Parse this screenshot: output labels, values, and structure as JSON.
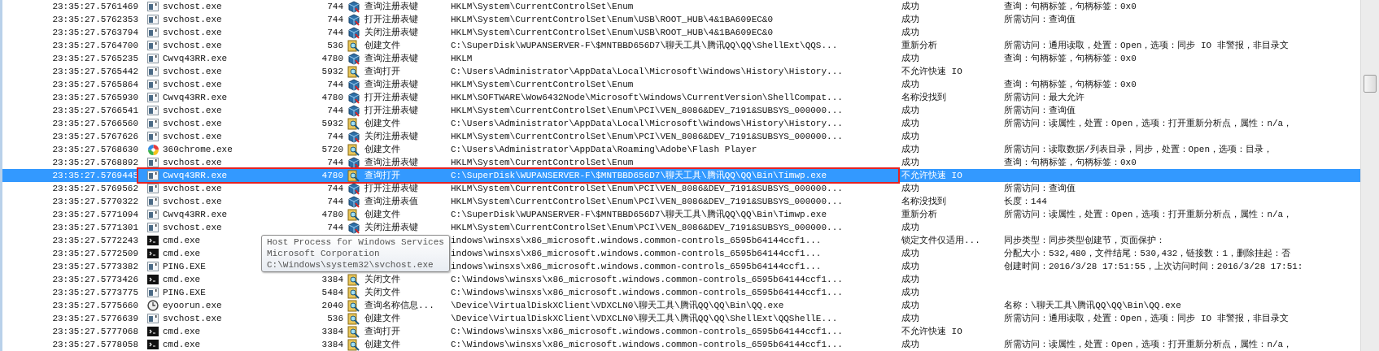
{
  "rows": [
    {
      "time": "23:35:27.5761469",
      "process": {
        "text": "svchost.exe",
        "kind": "app"
      },
      "pid": "744",
      "operation": {
        "text": "查询注册表键",
        "kind": "registry"
      },
      "path": "HKLM\\System\\CurrentControlSet\\Enum",
      "result": "成功",
      "detail": "查询：句柄标签，句柄标签：0x0",
      "selected": false,
      "outlined": false
    },
    {
      "time": "23:35:27.5762353",
      "process": {
        "text": "svchost.exe",
        "kind": "app"
      },
      "pid": "744",
      "operation": {
        "text": "打开注册表键",
        "kind": "registry"
      },
      "path": "HKLM\\System\\CurrentControlSet\\Enum\\USB\\ROOT_HUB\\4&1BA609EC&0",
      "result": "成功",
      "detail": "所需访问：查询值",
      "selected": false,
      "outlined": false
    },
    {
      "time": "23:35:27.5763794",
      "process": {
        "text": "svchost.exe",
        "kind": "app"
      },
      "pid": "744",
      "operation": {
        "text": "关闭注册表键",
        "kind": "registry"
      },
      "path": "HKLM\\System\\CurrentControlSet\\Enum\\USB\\ROOT_HUB\\4&1BA609EC&0",
      "result": "成功",
      "selected": false,
      "outlined": false
    },
    {
      "time": "23:35:27.5764700",
      "process": {
        "text": "svchost.exe",
        "kind": "app"
      },
      "pid": "536",
      "operation": {
        "text": "创建文件",
        "kind": "file"
      },
      "path": "C:\\SuperDisk\\WUPANSERVER-F\\$MNTBBD656D7\\聊天工具\\腾讯QQ\\QQ\\ShellExt\\QQS...",
      "result": "重新分析",
      "detail": "所需访问：通用读取，处置：Open，选项：同步 IO 非警报，非目录文",
      "selected": false,
      "outlined": false
    },
    {
      "time": "23:35:27.5765235",
      "process": {
        "text": "Cwvq43RR.exe",
        "kind": "app"
      },
      "pid": "4780",
      "operation": {
        "text": "查询注册表键",
        "kind": "registry"
      },
      "path": "HKLM",
      "result": "成功",
      "detail": "查询：句柄标签，句柄标签：0x0",
      "selected": false,
      "outlined": false
    },
    {
      "time": "23:35:27.5765442",
      "process": {
        "text": "svchost.exe",
        "kind": "app"
      },
      "pid": "5932",
      "operation": {
        "text": "查询打开",
        "kind": "file"
      },
      "path": "C:\\Users\\Administrator\\AppData\\Local\\Microsoft\\Windows\\History\\History...",
      "result": "不允许快速 IO",
      "selected": false,
      "outlined": false
    },
    {
      "time": "23:35:27.5765864",
      "process": {
        "text": "svchost.exe",
        "kind": "app"
      },
      "pid": "744",
      "operation": {
        "text": "查询注册表键",
        "kind": "registry"
      },
      "path": "HKLM\\System\\CurrentControlSet\\Enum",
      "result": "成功",
      "detail": "查询：句柄标签，句柄标签：0x0",
      "selected": false,
      "outlined": false
    },
    {
      "time": "23:35:27.5765930",
      "process": {
        "text": "Cwvq43RR.exe",
        "kind": "app"
      },
      "pid": "4780",
      "operation": {
        "text": "打开注册表键",
        "kind": "registry"
      },
      "path": "HKLM\\SOFTWARE\\Wow6432Node\\Microsoft\\Windows\\CurrentVersion\\ShellCompat...",
      "result": "名称没找到",
      "detail": "所需访问：最大允许",
      "selected": false,
      "outlined": false
    },
    {
      "time": "23:35:27.5766541",
      "process": {
        "text": "svchost.exe",
        "kind": "app"
      },
      "pid": "744",
      "operation": {
        "text": "打开注册表键",
        "kind": "registry"
      },
      "path": "HKLM\\System\\CurrentControlSet\\Enum\\PCI\\VEN_8086&DEV_7191&SUBSYS_000000...",
      "result": "成功",
      "detail": "所需访问：查询值",
      "selected": false,
      "outlined": false
    },
    {
      "time": "23:35:27.5766560",
      "process": {
        "text": "svchost.exe",
        "kind": "app"
      },
      "pid": "5932",
      "operation": {
        "text": "创建文件",
        "kind": "file"
      },
      "path": "C:\\Users\\Administrator\\AppData\\Local\\Microsoft\\Windows\\History\\History...",
      "result": "成功",
      "detail": "所需访问：读属性，处置：Open，选项：打开重新分析点，属性：n/a，",
      "selected": false,
      "outlined": false
    },
    {
      "time": "23:35:27.5767626",
      "process": {
        "text": "svchost.exe",
        "kind": "app"
      },
      "pid": "744",
      "operation": {
        "text": "关闭注册表键",
        "kind": "registry"
      },
      "path": "HKLM\\System\\CurrentControlSet\\Enum\\PCI\\VEN_8086&DEV_7191&SUBSYS_000000...",
      "result": "成功",
      "selected": false,
      "outlined": false
    },
    {
      "time": "23:35:27.5768630",
      "process": {
        "text": "360chrome.exe",
        "kind": "multicolor"
      },
      "pid": "5720",
      "operation": {
        "text": "创建文件",
        "kind": "file"
      },
      "path": "C:\\Users\\Administrator\\AppData\\Roaming\\Adobe\\Flash Player",
      "result": "成功",
      "detail": "所需访问：读取数据/列表目录，同步，处置：Open，选项：目录，",
      "selected": false,
      "outlined": false
    },
    {
      "time": "23:35:27.5768892",
      "process": {
        "text": "svchost.exe",
        "kind": "app"
      },
      "pid": "744",
      "operation": {
        "text": "查询注册表键",
        "kind": "registry"
      },
      "path": "HKLM\\System\\CurrentControlSet\\Enum",
      "result": "成功",
      "detail": "查询：句柄标签，句柄标签：0x0",
      "selected": false,
      "outlined": false
    },
    {
      "time": "23:35:27.5769445",
      "process": {
        "text": "Cwvq43RR.exe",
        "kind": "app"
      },
      "pid": "4780",
      "operation": {
        "text": "查询打开",
        "kind": "file"
      },
      "path": "C:\\SuperDisk\\WUPANSERVER-F\\$MNTBBD656D7\\聊天工具\\腾讯QQ\\QQ\\Bin\\Timwp.exe",
      "result": "不允许快速 IO",
      "selected": true,
      "outlined": true
    },
    {
      "time": "23:35:27.5769562",
      "process": {
        "text": "svchost.exe",
        "kind": "app"
      },
      "pid": "744",
      "operation": {
        "text": "打开注册表键",
        "kind": "registry"
      },
      "path": "HKLM\\System\\CurrentControlSet\\Enum\\PCI\\VEN_8086&DEV_7191&SUBSYS_000000...",
      "result": "成功",
      "detail": "所需访问：查询值",
      "selected": false,
      "outlined": false
    },
    {
      "time": "23:35:27.5770322",
      "process": {
        "text": "svchost.exe",
        "kind": "app"
      },
      "pid": "744",
      "operation": {
        "text": "查询注册表值",
        "kind": "registry"
      },
      "path": "HKLM\\System\\CurrentControlSet\\Enum\\PCI\\VEN_8086&DEV_7191&SUBSYS_000000...",
      "result": "名称没找到",
      "detail": "长度：144",
      "selected": false,
      "outlined": false
    },
    {
      "time": "23:35:27.5771094",
      "process": {
        "text": "Cwvq43RR.exe",
        "kind": "app"
      },
      "pid": "4780",
      "operation": {
        "text": "创建文件",
        "kind": "file"
      },
      "path": "C:\\SuperDisk\\WUPANSERVER-F\\$MNTBBD656D7\\聊天工具\\腾讯QQ\\QQ\\Bin\\Timwp.exe",
      "result": "重新分析",
      "detail": "所需访问：读属性，处置：Open，选项：打开重新分析点，属性：n/a，",
      "selected": false,
      "outlined": false
    },
    {
      "time": "23:35:27.5771301",
      "process": {
        "text": "svchost.exe",
        "kind": "app"
      },
      "pid": "744",
      "operation": {
        "text": "关闭注册表键",
        "kind": "registry"
      },
      "path": "HKLM\\System\\CurrentControlSet\\Enum\\PCI\\VEN_8086&DEV_7191&SUBSYS_000000...",
      "result": "成功",
      "selected": false,
      "outlined": false
    },
    {
      "time": "23:35:27.5772243",
      "process": {
        "text": "cmd.exe",
        "kind": "console"
      },
      "path": "indows\\winsxs\\x86_microsoft.windows.common-controls_6595b64144ccf1...",
      "result": "锁定文件仅适用...",
      "detail": "同步类型：同步类型创建节，页面保护：",
      "selected": false,
      "outlined": false
    },
    {
      "time": "23:35:27.5772509",
      "process": {
        "text": "cmd.exe",
        "kind": "console"
      },
      "path": "indows\\winsxs\\x86_microsoft.windows.common-controls_6595b64144ccf1...",
      "result": "成功",
      "detail": "分配大小：532,480，文件结尾：530,432，链接数：1，删除挂起：否",
      "selected": false,
      "outlined": false
    },
    {
      "time": "23:35:27.5773382",
      "process": {
        "text": "PING.EXE",
        "kind": "app"
      },
      "path": "indows\\winsxs\\x86_microsoft.windows.common-controls_6595b64144ccf1...",
      "result": "成功",
      "detail": "创建时间：2016/3/28 17:51:55，上次访问时间：2016/3/28 17:51:",
      "selected": false,
      "outlined": false
    },
    {
      "time": "23:35:27.5773426",
      "process": {
        "text": "cmd.exe",
        "kind": "console"
      },
      "pid": "3384",
      "operation": {
        "text": "关闭文件",
        "kind": "file"
      },
      "path": "C:\\Windows\\winsxs\\x86_microsoft.windows.common-controls_6595b64144ccf1...",
      "result": "成功",
      "selected": false,
      "outlined": false
    },
    {
      "time": "23:35:27.5773775",
      "process": {
        "text": "PING.EXE",
        "kind": "app"
      },
      "pid": "5484",
      "operation": {
        "text": "关闭文件",
        "kind": "file"
      },
      "path": "C:\\Windows\\winsxs\\x86_microsoft.windows.common-controls_6595b64144ccf1...",
      "result": "成功",
      "selected": false,
      "outlined": false
    },
    {
      "time": "23:35:27.5775660",
      "process": {
        "text": "eyoorun.exe",
        "kind": "clock"
      },
      "pid": "2040",
      "operation": {
        "text": "查询名称信息...",
        "kind": "file"
      },
      "path": "\\Device\\VirtualDiskXClient\\VDXCLN0\\聊天工具\\腾讯QQ\\QQ\\Bin\\QQ.exe",
      "result": "成功",
      "detail": "名称：\\聊天工具\\腾讯QQ\\QQ\\Bin\\QQ.exe",
      "selected": false,
      "outlined": false
    },
    {
      "time": "23:35:27.5776639",
      "process": {
        "text": "svchost.exe",
        "kind": "app"
      },
      "pid": "536",
      "operation": {
        "text": "创建文件",
        "kind": "file"
      },
      "path": "\\Device\\VirtualDiskXClient\\VDXCLN0\\聊天工具\\腾讯QQ\\QQ\\ShellExt\\QQShellE...",
      "result": "成功",
      "detail": "所需访问：通用读取，处置：Open，选项：同步 IO 非警报，非目录文",
      "selected": false,
      "outlined": false
    },
    {
      "time": "23:35:27.5777068",
      "process": {
        "text": "cmd.exe",
        "kind": "console"
      },
      "pid": "3384",
      "operation": {
        "text": "查询打开",
        "kind": "file"
      },
      "path": "C:\\Windows\\winsxs\\x86_microsoft.windows.common-controls_6595b64144ccf1...",
      "result": "不允许快速 IO",
      "selected": false,
      "outlined": false
    },
    {
      "time": "23:35:27.5778058",
      "process": {
        "text": "cmd.exe",
        "kind": "console"
      },
      "pid": "3384",
      "operation": {
        "text": "创建文件",
        "kind": "file"
      },
      "path": "C:\\Windows\\winsxs\\x86_microsoft.windows.common-controls_6595b64144ccf1...",
      "result": "成功",
      "detail": "所需访问：读属性，处置：Open，选项：打开重新分析点，属性：n/a，",
      "selected": false,
      "outlined": false
    }
  ],
  "tooltip": {
    "lines": [
      "Host Process for Windows Services",
      "Microsoft Corporation",
      "C:\\Windows\\system32\\svchost.exe"
    ]
  }
}
